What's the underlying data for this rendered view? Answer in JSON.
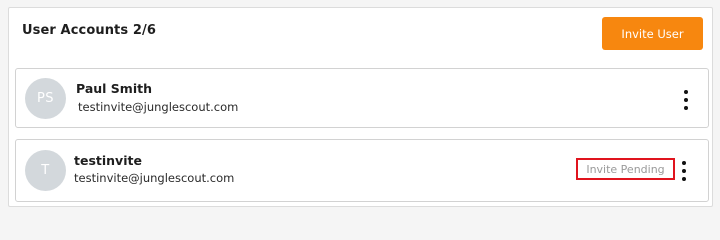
{
  "header": {
    "title": "User Accounts 2/6",
    "invite_button": "Invite User"
  },
  "colors": {
    "accent": "#f7870f",
    "highlight_border": "#e0141e",
    "avatar_bg": "#d3d8dc"
  },
  "users": [
    {
      "initials": "PS",
      "name": "Paul Smith",
      "email": "testinvite@junglescout.com",
      "status": "",
      "menu_icon": "more-vertical-icon"
    },
    {
      "initials": "T",
      "name": "testinvite",
      "email": "testinvite@junglescout.com",
      "status": "Invite Pending",
      "menu_icon": "more-vertical-icon"
    }
  ]
}
